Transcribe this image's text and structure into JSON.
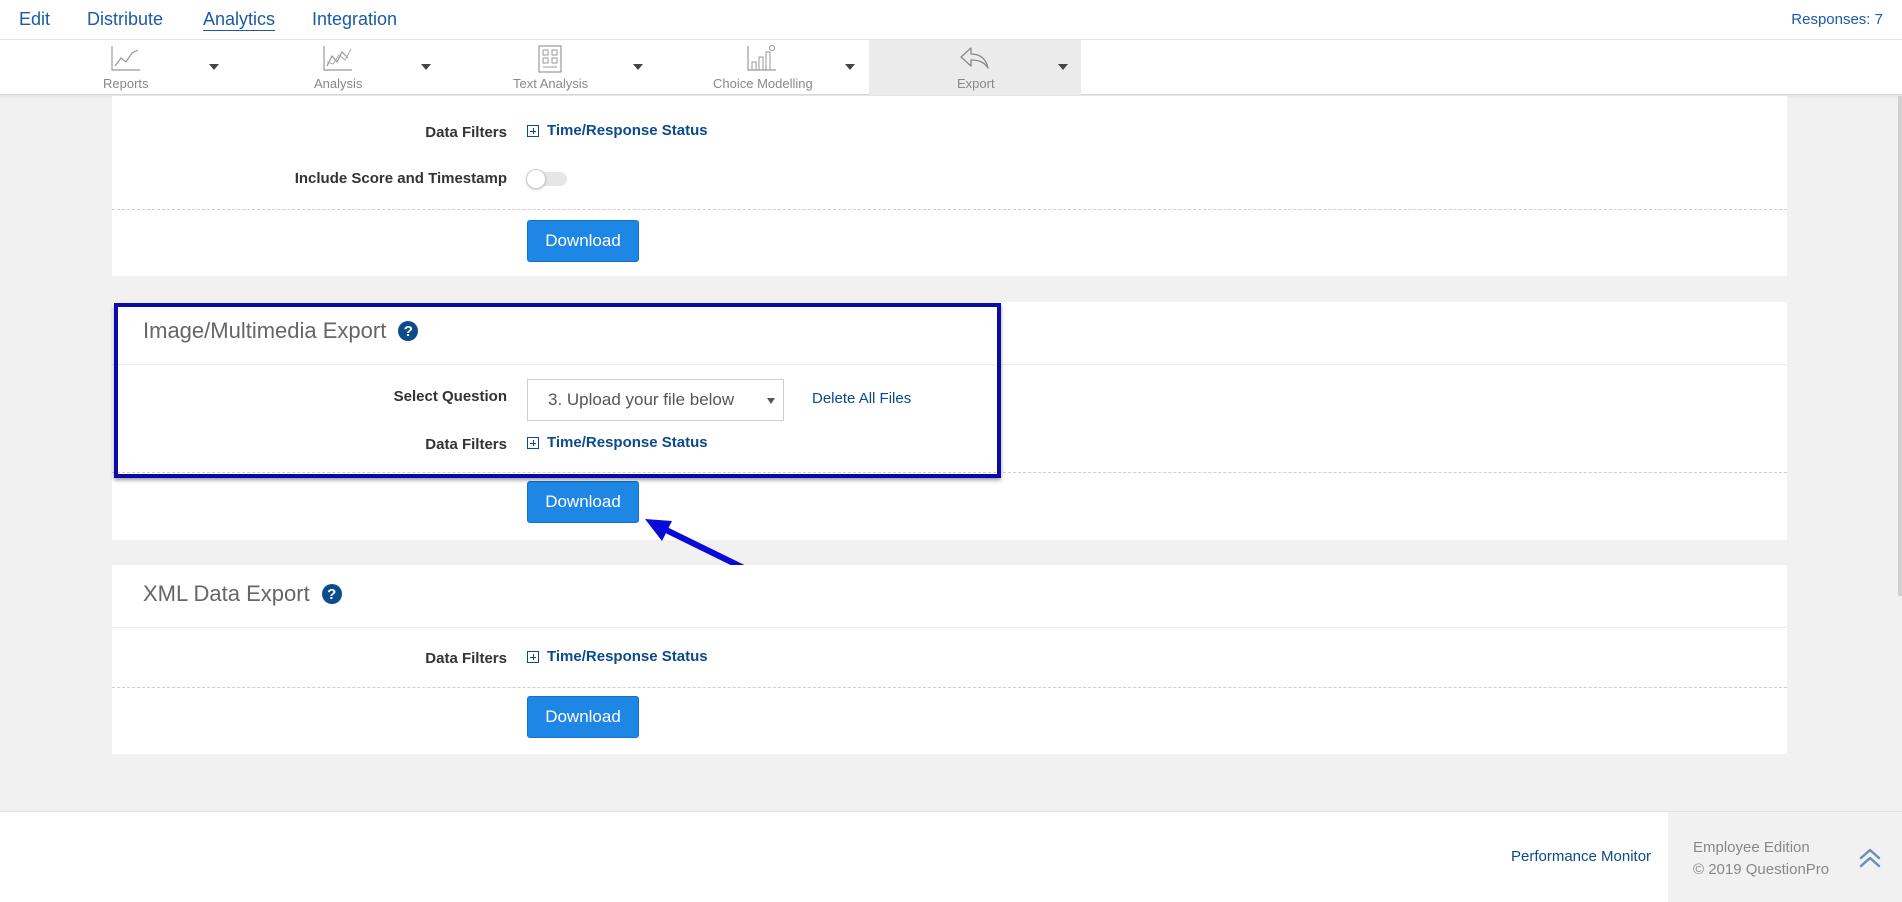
{
  "nav": {
    "tabs": [
      {
        "label": "Edit"
      },
      {
        "label": "Distribute"
      },
      {
        "label": "Analytics"
      },
      {
        "label": "Integration"
      }
    ],
    "responses": "Responses: 7"
  },
  "toolbar": {
    "items": [
      {
        "label": "Reports",
        "icon": "reports-chart-icon"
      },
      {
        "label": "Analysis",
        "icon": "analysis-chart-icon"
      },
      {
        "label": "Text Analysis",
        "icon": "text-analysis-icon"
      },
      {
        "label": "Choice Modelling",
        "icon": "choice-modelling-icon"
      },
      {
        "label": "Export",
        "icon": "export-reply-icon"
      }
    ]
  },
  "panel1": {
    "data_filters_label": "Data Filters",
    "filter_link": "Time/Response Status",
    "score_label": "Include Score and Timestamp",
    "score_toggle_on": false,
    "download": "Download"
  },
  "panel2": {
    "title": "Image/Multimedia Export",
    "help": "?",
    "select_label": "Select Question",
    "select_value": "3. Upload your file below",
    "delete_link": "Delete All Files",
    "data_filters_label": "Data Filters",
    "filter_link": "Time/Response Status",
    "download": "Download"
  },
  "panel3": {
    "title": "XML Data Export",
    "help": "?",
    "data_filters_label": "Data Filters",
    "filter_link": "Time/Response Status",
    "download": "Download"
  },
  "footer": {
    "performance_monitor": "Performance Monitor",
    "edition": "Employee Edition",
    "copyright": "© 2019 QuestionPro"
  },
  "colors": {
    "accent": "#1e87e5",
    "link": "#0b4a8b",
    "highlight": "#0a0aa8"
  }
}
